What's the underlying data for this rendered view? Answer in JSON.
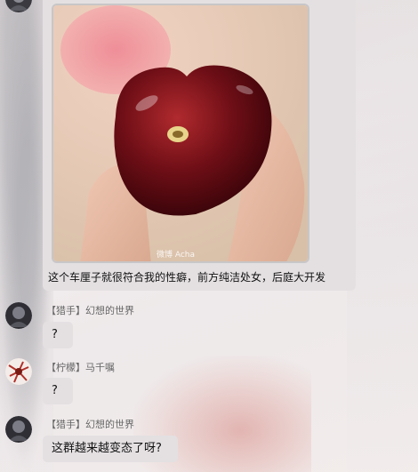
{
  "messages": [
    {
      "type": "image",
      "image_label": "cherry-held-between-fingers",
      "watermark": "微博 Acha",
      "text": "这个车厘子就很符合我的性癖，前方纯洁处女，后庭大开发"
    },
    {
      "sender": "【猎手】幻想的世界",
      "text": "?"
    },
    {
      "sender": "【柠檬】马千嘱",
      "text": "?"
    },
    {
      "sender": "【猎手】幻想的世界",
      "text": "这群越来越变态了呀?"
    }
  ],
  "colors": {
    "bubble": "#e4e0e2",
    "sender_text": "#666666",
    "message_text": "#111111"
  }
}
